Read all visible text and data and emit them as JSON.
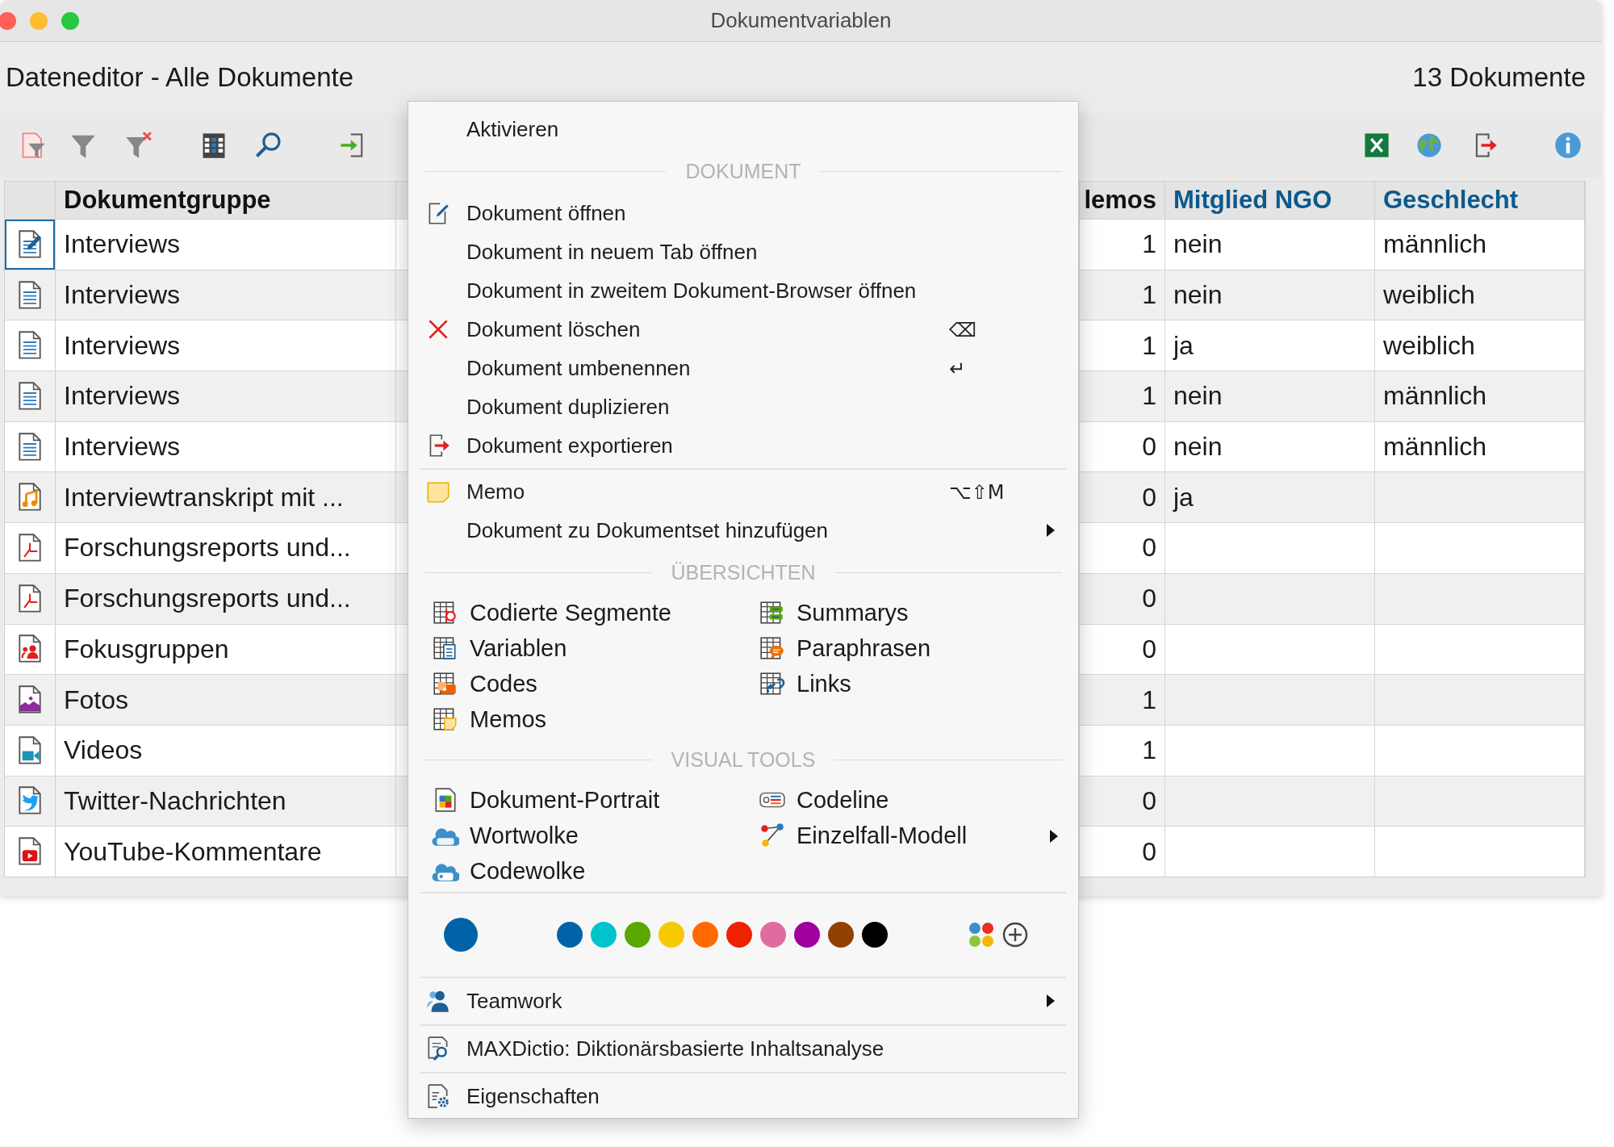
{
  "window": {
    "title": "Dokumentvariablen"
  },
  "header": {
    "title": "Dateneditor - Alle Dokumente",
    "count": "13 Dokumente"
  },
  "table": {
    "columns": [
      {
        "label": "Dokumentgruppe",
        "kind": "text",
        "variable": false
      },
      {
        "label": "lemos",
        "kind": "number",
        "variable": false
      },
      {
        "label": "Mitglied NGO",
        "kind": "text",
        "variable": true
      },
      {
        "label": "Geschlecht",
        "kind": "text",
        "variable": true
      }
    ],
    "rows": [
      {
        "kind": "edit",
        "selected": true,
        "cells": [
          "Interviews",
          "1",
          "nein",
          "männlich"
        ]
      },
      {
        "kind": "text",
        "selected": false,
        "cells": [
          "Interviews",
          "1",
          "nein",
          "weiblich"
        ]
      },
      {
        "kind": "text",
        "selected": false,
        "cells": [
          "Interviews",
          "1",
          "ja",
          "weiblich"
        ]
      },
      {
        "kind": "text",
        "selected": false,
        "cells": [
          "Interviews",
          "1",
          "nein",
          "männlich"
        ]
      },
      {
        "kind": "text",
        "selected": false,
        "cells": [
          "Interviews",
          "0",
          "nein",
          "männlich"
        ]
      },
      {
        "kind": "audio",
        "selected": false,
        "cells": [
          "Interviewtranskript mit ...",
          "0",
          "ja"
        ]
      },
      {
        "kind": "pdf",
        "selected": false,
        "cells": [
          "Forschungsreports und...",
          "0"
        ]
      },
      {
        "kind": "pdf",
        "selected": false,
        "cells": [
          "Forschungsreports und...",
          "0"
        ]
      },
      {
        "kind": "group",
        "selected": false,
        "cells": [
          "Fokusgruppen",
          "0"
        ]
      },
      {
        "kind": "image",
        "selected": false,
        "cells": [
          "Fotos",
          "1"
        ]
      },
      {
        "kind": "video",
        "selected": false,
        "cells": [
          "Videos",
          "1"
        ]
      },
      {
        "kind": "twitter",
        "selected": false,
        "cells": [
          "Twitter-Nachrichten",
          "0"
        ]
      },
      {
        "kind": "youtube",
        "selected": false,
        "cells": [
          "YouTube-Kommentare",
          "0"
        ]
      }
    ]
  },
  "menu": {
    "entries": [
      {
        "kind": "item",
        "label": "Aktivieren",
        "submenu": false
      },
      {
        "kind": "section",
        "label": "DOKUMENT"
      },
      {
        "kind": "item",
        "label": "Dokument öffnen",
        "submenu": false
      },
      {
        "kind": "item",
        "label": "Dokument in neuem Tab öffnen",
        "submenu": false
      },
      {
        "kind": "item",
        "label": "Dokument in zweitem Dokument-Browser öffnen",
        "submenu": false
      },
      {
        "kind": "item",
        "label": "Dokument löschen",
        "shortcut": "⌫",
        "submenu": false
      },
      {
        "kind": "item",
        "label": "Dokument umbenennen",
        "shortcut": "↵",
        "submenu": false
      },
      {
        "kind": "item",
        "label": "Dokument duplizieren",
        "submenu": false
      },
      {
        "kind": "item",
        "label": "Dokument exportieren",
        "submenu": false
      },
      {
        "kind": "separator"
      },
      {
        "kind": "item",
        "label": "Memo",
        "shortcut": "⌥⇧M",
        "submenu": false
      },
      {
        "kind": "item",
        "label": "Dokument zu Dokumentset hinzufügen",
        "submenu": true
      },
      {
        "kind": "section",
        "label": "ÜBERSICHTEN"
      },
      {
        "kind": "grid",
        "items": [
          {
            "label": "Codierte Segmente",
            "submenu": false
          },
          {
            "label": "Summarys",
            "submenu": false
          },
          {
            "label": "Variablen",
            "submenu": false
          },
          {
            "label": "Paraphrasen",
            "submenu": false
          },
          {
            "label": "Codes",
            "submenu": false
          },
          {
            "label": "Links",
            "submenu": false
          },
          {
            "label": "Memos",
            "submenu": false
          }
        ]
      },
      {
        "kind": "section",
        "label": "VISUAL TOOLS"
      },
      {
        "kind": "grid",
        "items": [
          {
            "label": "Dokument-Portrait",
            "submenu": false
          },
          {
            "label": "Codeline",
            "submenu": false
          },
          {
            "label": "Wortwolke",
            "submenu": false
          },
          {
            "label": "Einzelfall-Modell",
            "submenu": true
          },
          {
            "label": "Codewolke",
            "submenu": false
          }
        ]
      },
      {
        "kind": "separator"
      },
      {
        "kind": "colors",
        "current": {
          "color": "#0063a8"
        },
        "swatches": [
          {
            "color": "#0063a8"
          },
          {
            "color": "#00c3cc"
          },
          {
            "color": "#5aa700"
          },
          {
            "color": "#f5c800"
          },
          {
            "color": "#ff6a00"
          },
          {
            "color": "#ee2200"
          },
          {
            "color": "#e06c9f"
          },
          {
            "color": "#a0009e"
          },
          {
            "color": "#914000"
          },
          {
            "color": "#000000"
          }
        ]
      },
      {
        "kind": "separator"
      },
      {
        "kind": "item",
        "label": "Teamwork",
        "submenu": true
      },
      {
        "kind": "separator"
      },
      {
        "kind": "item",
        "label": "MAXDictio: Diktionärsbasierte Inhaltsanalyse",
        "submenu": false
      },
      {
        "kind": "separator"
      },
      {
        "kind": "item",
        "label": "Eigenschaften",
        "submenu": false
      }
    ]
  }
}
